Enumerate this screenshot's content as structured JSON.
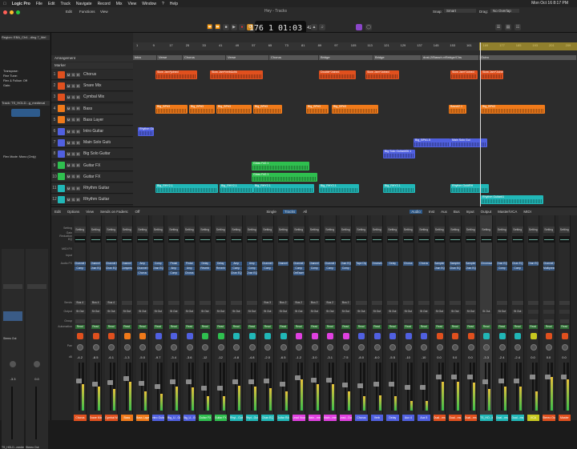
{
  "menubar": {
    "app": "Logic Pro",
    "items": [
      "File",
      "Edit",
      "Track",
      "Navigate",
      "Record",
      "Mix",
      "View",
      "Window",
      "?",
      "Help"
    ],
    "clock": "Mon Oct 16  8:17 PM"
  },
  "window": {
    "title": "Hey - Tracks"
  },
  "lcd": {
    "bar": "176",
    "beat": "1",
    "time": "01:03",
    "frames": "42"
  },
  "toolbar": {
    "edit": "Edit",
    "functions": "Functions",
    "view": "View",
    "snap_label": "Snap:",
    "snap_value": "Smart",
    "drag_label": "Drag:",
    "drag_value": "No Overlap"
  },
  "inspector": {
    "region_label": "Region:",
    "region_name": "EBA_Ch4...ding 7_Mel",
    "track_label": "Track:",
    "track_name": "TS_HOLD...g_medieval",
    "rows": [
      [
        "Transpose:",
        ""
      ],
      [
        "Fine Tune:",
        ""
      ],
      [
        "Flex & Follow:",
        "Off"
      ],
      [
        "Gain:",
        ""
      ]
    ],
    "flex_mode_label": "Flex Mode:",
    "flex_mode": "Mono (Only)"
  },
  "arrange": {
    "global_arrangement": "Arrangement",
    "global_marker": "Marker",
    "ruler": [
      "1",
      "9",
      "17",
      "25",
      "33",
      "41",
      "49",
      "57",
      "65",
      "73",
      "81",
      "89",
      "97",
      "105",
      "113",
      "121",
      "129",
      "137",
      "145",
      "153",
      "161",
      "169",
      "177",
      "185",
      "193",
      "201",
      "209"
    ],
    "markers": [
      {
        "label": "Intro"
      },
      {
        "label": "Verse"
      },
      {
        "label": "Chorus"
      },
      {
        "label": "Verse"
      },
      {
        "label": "Chorus"
      },
      {
        "label": "Bridge"
      },
      {
        "label": "Bridge"
      },
      {
        "label": "dust-2/Bass/v.v/Bridge/Chs"
      },
      {
        "label": "Outro"
      }
    ]
  },
  "tracks": [
    {
      "num": "1",
      "name": "Chorus",
      "color": "#e0501e"
    },
    {
      "num": "2",
      "name": "Snare Mix",
      "color": "#e0501e"
    },
    {
      "num": "3",
      "name": "Cymbal Mix",
      "color": "#e0501e"
    },
    {
      "num": "4",
      "name": "Bass",
      "color": "#f07a1a"
    },
    {
      "num": "5",
      "name": "Bass Layer",
      "color": "#f07a1a"
    },
    {
      "num": "6",
      "name": "Intro Guitar",
      "color": "#5060e0"
    },
    {
      "num": "7",
      "name": "Main Solo Guitar",
      "color": "#5060e0"
    },
    {
      "num": "8",
      "name": "Big Solo Guitar",
      "color": "#5060e0"
    },
    {
      "num": "9",
      "name": "Guitar FX",
      "color": "#2fbf4f"
    },
    {
      "num": "10",
      "name": "Guitar FX",
      "color": "#2fbf4f"
    },
    {
      "num": "11",
      "name": "Rhythm Guitar",
      "color": "#21b7b7"
    },
    {
      "num": "12",
      "name": "Rhythm Guitar L",
      "color": "#21b7b7"
    }
  ],
  "regions": [
    {
      "track": 0,
      "label": "Slow Jam*joined",
      "color": "#e0501e"
    },
    {
      "track": 0,
      "label": "Slow Jam*verb&chk",
      "color": "#e0501e"
    },
    {
      "track": 0,
      "label": "Double*Joined",
      "color": "#e0501e"
    },
    {
      "track": 0,
      "label": "Slow Jam*Joined",
      "color": "#e0501e"
    },
    {
      "track": 0,
      "label": "Slow Jam*Joined",
      "color": "#e0501e"
    },
    {
      "track": 0,
      "label": "Slow Jam*Joined",
      "color": "#e0501e"
    },
    {
      "track": 3,
      "label": "Big_BP#3",
      "color": "#f07a1a"
    },
    {
      "track": 3,
      "label": "Big_BP#3",
      "color": "#f07a1a"
    },
    {
      "track": 3,
      "label": "Big_BP#3",
      "color": "#f07a1a"
    },
    {
      "track": 3,
      "label": "Big_BP#3",
      "color": "#f07a1a"
    },
    {
      "track": 3,
      "label": "Big_BP#3",
      "color": "#f07a1a"
    },
    {
      "track": 3,
      "label": "Big_BP#3",
      "color": "#f07a1a"
    },
    {
      "track": 3,
      "label": "Bass#2.1",
      "color": "#f07a1a"
    },
    {
      "track": 3,
      "label": "Big_BP#3",
      "color": "#f07a1a"
    },
    {
      "track": 5,
      "label": "Rhythm Gui",
      "color": "#5060e0"
    },
    {
      "track": 6,
      "label": "Big_BP#1.5",
      "color": "#5060e0"
    },
    {
      "track": 6,
      "label": "Main Solo Gui",
      "color": "#5060e0"
    },
    {
      "track": 7,
      "label": "Big Solo Guitar#06.1",
      "color": "#5060e0"
    },
    {
      "track": 8,
      "label": "Glass F#2.1",
      "color": "#2fbf4f"
    },
    {
      "track": 9,
      "label": "Glass F#2.1",
      "color": "#2fbf4f"
    },
    {
      "track": 10,
      "label": "Big_RHY2.1",
      "color": "#21b7b7"
    },
    {
      "track": 10,
      "label": "Big_RHY2.1",
      "color": "#21b7b7"
    },
    {
      "track": 10,
      "label": "Big_RHY2.1",
      "color": "#21b7b7"
    },
    {
      "track": 10,
      "label": "Big_RHY2.1",
      "color": "#21b7b7"
    },
    {
      "track": 10,
      "label": "Big_RHY2.1",
      "color": "#21b7b7"
    },
    {
      "track": 10,
      "label": "Rhythm Gui#RH",
      "color": "#21b7b7"
    },
    {
      "track": 11,
      "label": "Rhythm Guitar#1",
      "color": "#21b7b7"
    }
  ],
  "mixer": {
    "toolbar": [
      "Edit",
      "Options",
      "View",
      "Sends on Faders:",
      "Off"
    ],
    "filters": [
      "Single",
      "Tracks",
      "All"
    ],
    "right_filters": [
      "Audio",
      "Inst",
      "Aux",
      "Bus",
      "Input",
      "Output",
      "Master/VCA",
      "MIDI"
    ],
    "row_labels": [
      "Setting",
      "Gain Reduction",
      "EQ",
      "MIDI FX",
      "Input",
      "Audio FX",
      "Sends",
      "Output",
      "Group",
      "Automation",
      "Pan",
      "dB"
    ],
    "strips": [
      {
        "name": "Chorus",
        "plugins": [
          "Channel EQ",
          "Comp"
        ],
        "send": "Bus 4",
        "output": "St Out",
        "vol": "-4.2",
        "color": "#e0501e",
        "level": 0.55,
        "fader": 0.62
      },
      {
        "name": "Snare Mix",
        "plugins": [
          "Channel EQ",
          "Chan EQ"
        ],
        "send": "Bus 4",
        "output": "St Out",
        "vol": "-8.5",
        "color": "#e0501e",
        "level": 0.5,
        "fader": 0.55
      },
      {
        "name": "Cymbal Mix",
        "plugins": [
          "Channel EQ",
          "Chan EQ"
        ],
        "send": "Bus 4",
        "output": "St Out",
        "vol": "-6.1",
        "color": "#e0501e",
        "level": 0.45,
        "fader": 0.58
      },
      {
        "name": "Bass",
        "plugins": [
          "Channel EQ",
          "Compressor"
        ],
        "send": "",
        "output": "St Out",
        "vol": "-1.3",
        "color": "#f07a1a",
        "level": 0.6,
        "fader": 0.66
      },
      {
        "name": "Bass Layer",
        "plugins": [
          "Amp",
          "Channel EQ",
          "Chorus"
        ],
        "send": "",
        "output": "St Out",
        "vol": "-5.0",
        "color": "#f07a1a",
        "level": 0.4,
        "fader": 0.57
      },
      {
        "name": "Intro Guitar",
        "plugins": [
          "Comp",
          "Chan EQ"
        ],
        "send": "",
        "output": "St Out",
        "vol": "-9.7",
        "color": "#5060e0",
        "level": 0.35,
        "fader": 0.5
      },
      {
        "name": "Big_U...Guitar",
        "plugins": [
          "Pedal",
          "Amp",
          "Comp"
        ],
        "send": "",
        "output": "St Out",
        "vol": "-3.4",
        "color": "#5060e0",
        "level": 0.5,
        "fader": 0.6
      },
      {
        "name": "Big_U...Guitar",
        "plugins": [
          "Pedal",
          "Amp",
          "Chorus"
        ],
        "send": "",
        "output": "St Out",
        "vol": "-3.6",
        "color": "#5060e0",
        "level": 0.48,
        "fader": 0.6
      },
      {
        "name": "Guitar FX",
        "plugins": [
          "Delay",
          "Reverb"
        ],
        "send": "",
        "output": "St Out",
        "vol": "-12",
        "color": "#2fbf4f",
        "level": 0.3,
        "fader": 0.46
      },
      {
        "name": "Guitar FX",
        "plugins": [
          "Delay",
          "Reverb"
        ],
        "send": "",
        "output": "St Out",
        "vol": "-12",
        "color": "#2fbf4f",
        "level": 0.3,
        "fader": 0.46
      },
      {
        "name": "Rhyt...Guitar",
        "plugins": [
          "Amp",
          "Comp",
          "Chan EQ"
        ],
        "send": "",
        "output": "St Out",
        "vol": "-4.8",
        "color": "#21b7b7",
        "level": 0.52,
        "fader": 0.6
      },
      {
        "name": "Rhyt...Guitar",
        "plugins": [
          "Amp",
          "Comp",
          "Chan EQ"
        ],
        "send": "",
        "output": "St Out",
        "vol": "-4.8",
        "color": "#21b7b7",
        "level": 0.5,
        "fader": 0.6
      },
      {
        "name": "Chan EQ",
        "plugins": [
          "Channel EQ",
          "Comp"
        ],
        "send": "Bus 3",
        "output": "St Out",
        "vol": "-2.0",
        "color": "#21b7b7",
        "level": 0.46,
        "fader": 0.62
      },
      {
        "name": "Guitar RAR",
        "plugins": [
          "Channel EQ"
        ],
        "send": "Bus 2",
        "output": "St Out",
        "vol": "-6.5",
        "color": "#21b7b7",
        "level": 0.4,
        "fader": 0.55
      },
      {
        "name": "Lead Vocal",
        "plugins": [
          "Channel EQ",
          "Comp",
          "DeEsser"
        ],
        "send": "Bus 2",
        "output": "St Out",
        "vol": "-1.2",
        "color": "#e040e0",
        "level": 0.65,
        "fader": 0.68
      },
      {
        "name": "Main...ment",
        "plugins": [
          "Channel EQ",
          "Comp"
        ],
        "send": "Bus 2",
        "output": "St Out",
        "vol": "-3.0",
        "color": "#e040e0",
        "level": 0.55,
        "fader": 0.63
      },
      {
        "name": "Main...ment",
        "plugins": [
          "Channel EQ",
          "Comp"
        ],
        "send": "Bus 2",
        "output": "St Out",
        "vol": "-3.1",
        "color": "#e040e0",
        "level": 0.55,
        "fader": 0.63
      },
      {
        "name": "Lead...Dubbe",
        "plugins": [
          "Chan EQ",
          "Comp"
        ],
        "send": "Bus 2",
        "output": "St Out",
        "vol": "-7.5",
        "color": "#e040e0",
        "level": 0.4,
        "fader": 0.54
      },
      {
        "name": "Chorus",
        "plugins": [
          "Tape Dly"
        ],
        "send": "",
        "output": "St Out",
        "vol": "-8.0",
        "color": "#5060e0",
        "level": 0.3,
        "fader": 0.52
      },
      {
        "name": "Verb",
        "plugins": [
          "ChromaVerb"
        ],
        "send": "",
        "output": "St Out",
        "vol": "-6.0",
        "color": "#5060e0",
        "level": 0.32,
        "fader": 0.55
      },
      {
        "name": "Delay",
        "plugins": [
          "Delay"
        ],
        "send": "",
        "output": "St Out",
        "vol": "-5.5",
        "color": "#5060e0",
        "level": 0.3,
        "fader": 0.55
      },
      {
        "name": "Aux 4",
        "plugins": [
          "Chorus"
        ],
        "send": "",
        "output": "St Out",
        "vol": "-10",
        "color": "#5060e0",
        "level": 0.2,
        "fader": 0.48
      },
      {
        "name": "Aux 5",
        "plugins": [
          "Chorus"
        ],
        "send": "",
        "output": "St Out",
        "vol": "-10",
        "color": "#5060e0",
        "level": 0.2,
        "fader": 0.48
      },
      {
        "name": "Dual...ms",
        "plugins": [
          "Sampler",
          "Chan EQ"
        ],
        "send": "",
        "output": "St Out",
        "vol": "0.0",
        "color": "#e0501e",
        "level": 0.6,
        "fader": 0.7
      },
      {
        "name": "Dual...ms",
        "plugins": [
          "Sampler",
          "Chan EQ"
        ],
        "send": "",
        "output": "St Out",
        "vol": "0.0",
        "color": "#e0501e",
        "level": 0.6,
        "fader": 0.7
      },
      {
        "name": "Dual...ms",
        "plugins": [
          "Sampler",
          "Chan EQ"
        ],
        "send": "",
        "output": "St Out",
        "vol": "0.0",
        "color": "#e0501e",
        "level": 0.58,
        "fader": 0.7
      },
      {
        "name": "TS_HO...ling",
        "plugins": [
          "Chromaverb"
        ],
        "send": "",
        "output": "St Out",
        "vol": "-3.3",
        "color": "#21b7b7",
        "level": 0.45,
        "fader": 0.6
      },
      {
        "name": "Dual...ms",
        "plugins": [
          "Chan EQ",
          "Comp"
        ],
        "send": "",
        "output": "St Out",
        "vol": "-2.4",
        "color": "#21b7b7",
        "level": 0.5,
        "fader": 0.62
      },
      {
        "name": "Dual...ms",
        "plugins": [
          "Chan EQ",
          "Comp"
        ],
        "send": "",
        "output": "St Out",
        "vol": "-2.4",
        "color": "#21b7b7",
        "level": 0.5,
        "fader": 0.62
      },
      {
        "name": "VCA",
        "plugins": [
          "Chan EQ"
        ],
        "send": "",
        "output": "",
        "vol": "0.0",
        "color": "#c8c820",
        "level": 0.4,
        "fader": 0.7
      },
      {
        "name": "Stereo Out",
        "plugins": [
          "Channel EQ",
          "Multipressor"
        ],
        "send": "",
        "output": "",
        "vol": "0.0",
        "color": "#e0501e",
        "level": 0.7,
        "fader": 0.7
      },
      {
        "name": "Master",
        "plugins": [],
        "send": "",
        "output": "",
        "vol": "0.0",
        "color": "#e0501e",
        "level": 0.65,
        "fader": 0.7
      }
    ]
  },
  "left_strips": [
    {
      "name": "TS_HOLD...medieval",
      "vol": "-3.3",
      "output": "Stereo Out"
    },
    {
      "name": "Stereo Out",
      "vol": "0.0",
      "output": ""
    }
  ]
}
